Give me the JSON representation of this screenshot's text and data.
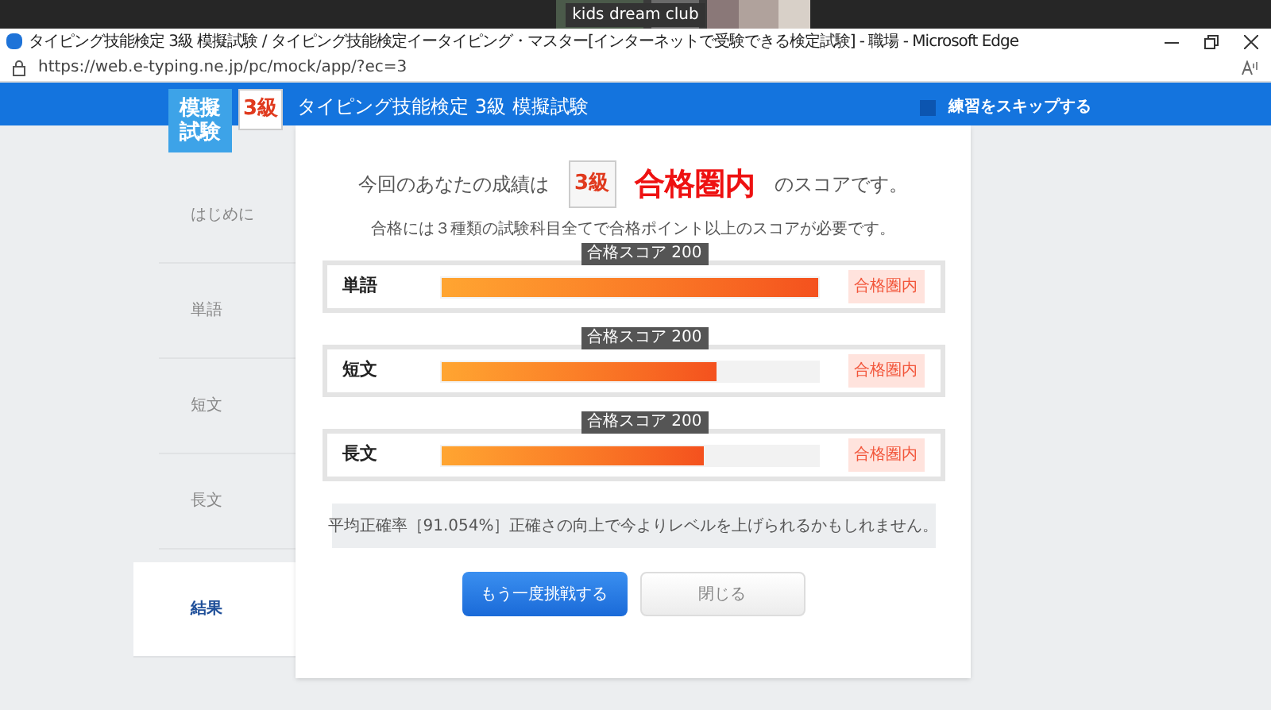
{
  "meeting_bar": {
    "label": "kids dream club"
  },
  "window": {
    "title": "タイピング技能検定 3級 模擬試験 / タイピング技能検定イータイピング・マスター[インターネットで受験できる検定試験] - 職場 - Microsoft Edge"
  },
  "address_bar": {
    "url": "https://web.e-typing.ne.jp/pc/mock/app/?ec=3"
  },
  "header": {
    "logo": "模擬試験",
    "grade": "3級",
    "title": "タイピング技能検定 3級 模擬試験",
    "skip_label": "練習をスキップする",
    "skip_checked": false
  },
  "sidebar": {
    "items": [
      {
        "label": "はじめに",
        "selected": false
      },
      {
        "label": "単語",
        "selected": false
      },
      {
        "label": "短文",
        "selected": false
      },
      {
        "label": "長文",
        "selected": false
      },
      {
        "label": "結果",
        "selected": true
      }
    ]
  },
  "result": {
    "lead": "今回のあなたの成績は",
    "grade": "3級",
    "verdict": "合格圏内",
    "tail": "のスコアです。",
    "note": "合格には３種類の試験科目全てで合格ポイント以上のスコアが必要です。",
    "subjects": [
      {
        "name": "単語",
        "marker": "合格スコア 200",
        "level": 1.0,
        "status": "合格圏内"
      },
      {
        "name": "短文",
        "marker": "合格スコア 200",
        "level": 0.73,
        "status": "合格圏内"
      },
      {
        "name": "長文",
        "marker": "合格スコア 200",
        "level": 0.7,
        "status": "合格圏内"
      }
    ],
    "accuracy": "平均正確率［91.054%］正確さの向上で今よりレベルを上げられるかもしれません。",
    "buttons": [
      {
        "label": "もう一度挑戦する",
        "kind": "primary"
      },
      {
        "label": "閉じる",
        "kind": "secondary"
      }
    ]
  }
}
